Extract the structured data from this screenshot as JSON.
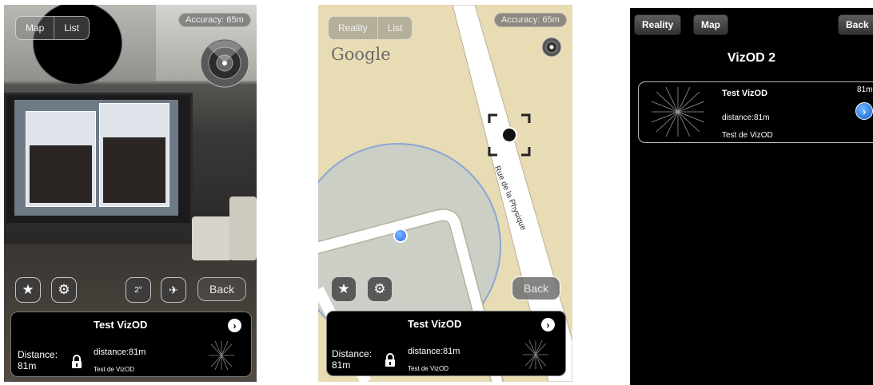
{
  "reality_view": {
    "toggle": [
      "Map",
      "List"
    ],
    "accuracy": "Accuracy: 65m",
    "tilt_label": "2°",
    "back_label": "Back",
    "panel": {
      "title": "Test VizOD",
      "distance_label": "Distance:",
      "distance_value": "81m",
      "distance_line": "distance:81m",
      "description": "Test de VizOD"
    }
  },
  "map_view": {
    "toggle": [
      "Reality",
      "List"
    ],
    "accuracy": "Accuracy: 65m",
    "google_label": "Google",
    "street_label": "Rue de la Physique",
    "back_label": "Back",
    "panel": {
      "title": "Test VizOD",
      "distance_label": "Distance:",
      "distance_value": "81m",
      "distance_line": "distance:81m",
      "description": "Test de VizOD"
    }
  },
  "list_view": {
    "nav": {
      "reality_label": "Reality",
      "map_label": "Map",
      "back_label": "Back"
    },
    "title": "VizOD 2",
    "item": {
      "title": "Test VizOD",
      "distance": "81m",
      "distance_line": "distance:81m",
      "description": "Test de VizOD"
    }
  },
  "icons": {
    "favorite": "star-icon",
    "settings": "gear-icon",
    "detail": "chevron-right-icon",
    "lock": "lock-icon",
    "location": "blue-dot-icon"
  },
  "colors": {
    "map_land": "#e8dcb4",
    "map_accuracy_circle": "#9db3d6",
    "location_dot": "#2a6df4",
    "disclosure_blue": "#1f74e0"
  }
}
